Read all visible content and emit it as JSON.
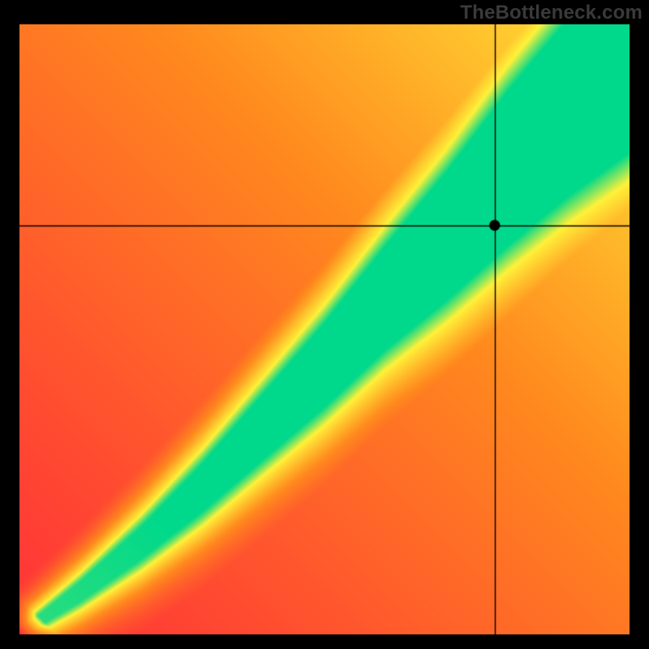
{
  "watermark": "TheBottleneck.com",
  "colors": {
    "red": "#ff2a3b",
    "orange": "#ff8a1e",
    "yellow": "#fff23a",
    "green": "#00d98b",
    "crosshair": "#000000",
    "marker": "#000000",
    "frame": "#000000"
  },
  "chart_data": {
    "type": "heatmap",
    "title": "",
    "xlabel": "",
    "ylabel": "",
    "xlim": [
      0,
      100
    ],
    "ylim": [
      0,
      100
    ],
    "grid": false,
    "legend": false,
    "ridge": {
      "description": "Green optimal band along a slightly super-linear diagonal from bottom-left to top-right; width grows with x.",
      "center_points_xy": [
        [
          0,
          0
        ],
        [
          10,
          7
        ],
        [
          20,
          15
        ],
        [
          30,
          24
        ],
        [
          40,
          34
        ],
        [
          50,
          44
        ],
        [
          60,
          55
        ],
        [
          70,
          65
        ],
        [
          80,
          76
        ],
        [
          90,
          86
        ],
        [
          100,
          95
        ]
      ],
      "halfwidth_percent_at_x": [
        [
          0,
          0.5
        ],
        [
          20,
          2.5
        ],
        [
          40,
          4.5
        ],
        [
          60,
          6.5
        ],
        [
          80,
          9.0
        ],
        [
          100,
          11.0
        ]
      ]
    },
    "crosshair": {
      "x": 78,
      "y": 67
    },
    "marker": {
      "x": 78,
      "y": 67,
      "r_percent": 0.9
    }
  }
}
